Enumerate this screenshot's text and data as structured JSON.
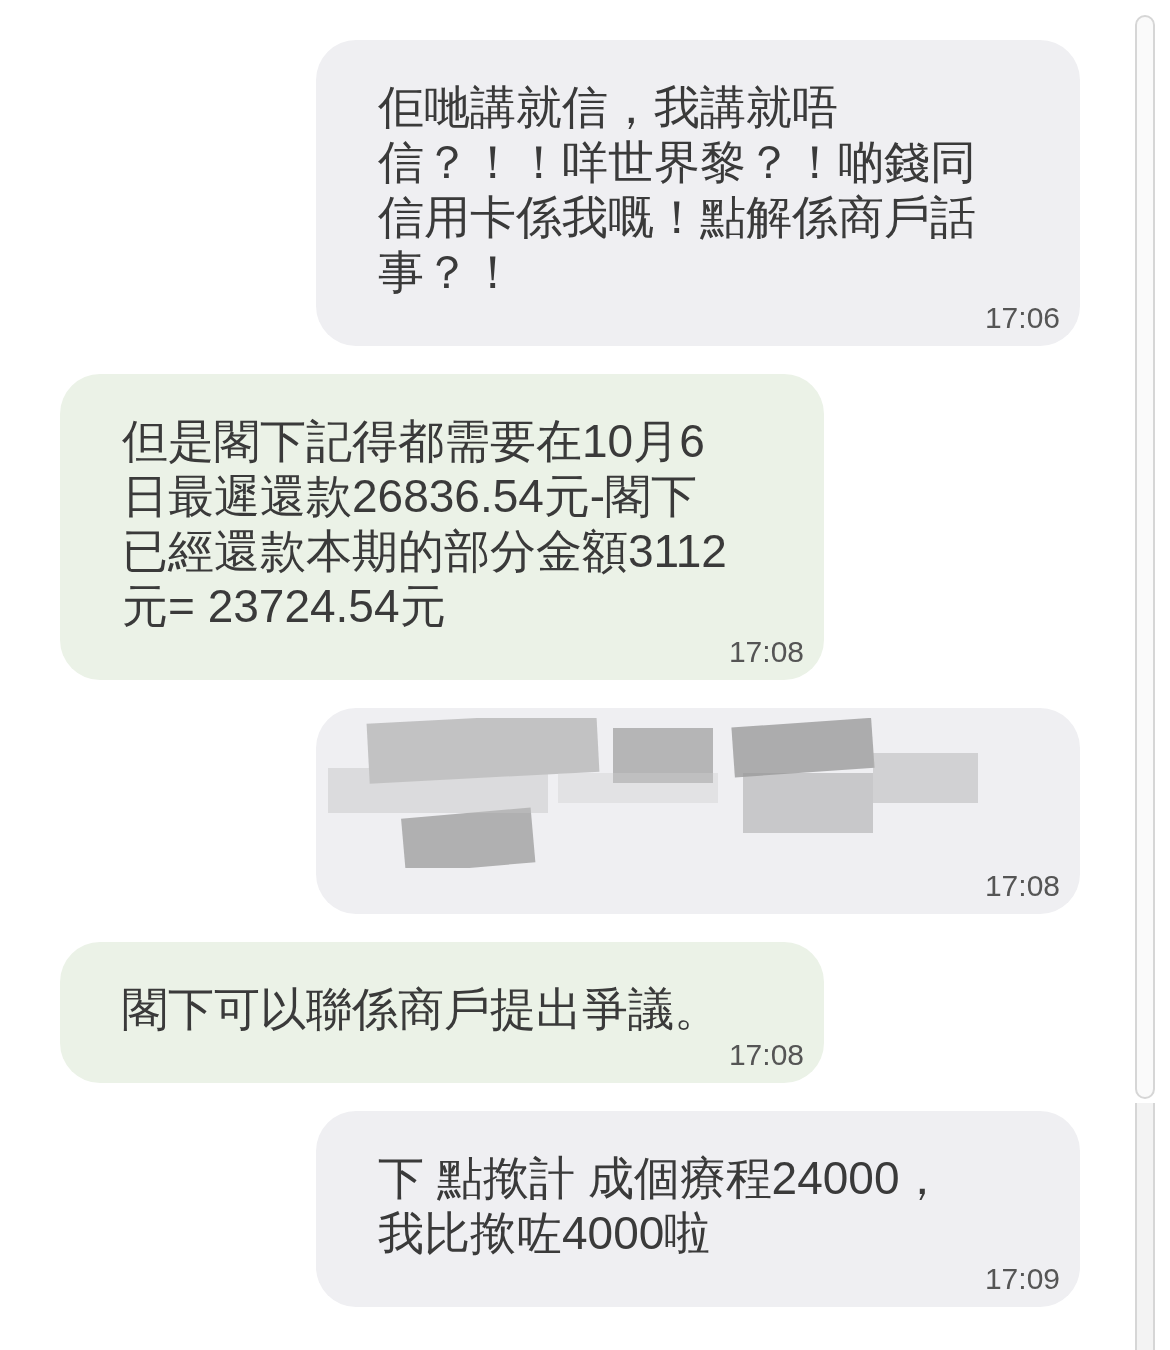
{
  "messages": [
    {
      "kind": "sent",
      "lines": [
        "佢哋講就信，我講就唔",
        "信？！！咩世界黎？！啲錢同",
        "信用卡係我嘅！點解係商戶話",
        "事？！"
      ],
      "time": "17:06"
    },
    {
      "kind": "received",
      "lines": [
        "但是閣下記得都需要在10月6",
        "日最遲還款26836.54元-閣下",
        "已經還款本期的部分金額3112",
        "元= 23724.54元"
      ],
      "time": "17:08"
    },
    {
      "kind": "redacted",
      "time": "17:08"
    },
    {
      "kind": "received",
      "lines": [
        "閣下可以聯係商戶提出爭議。"
      ],
      "time": "17:08"
    },
    {
      "kind": "sent",
      "lines": [
        "下 點揿計 成個療程24000，",
        "我比揿咗4000啦"
      ],
      "time": "17:09"
    }
  ]
}
